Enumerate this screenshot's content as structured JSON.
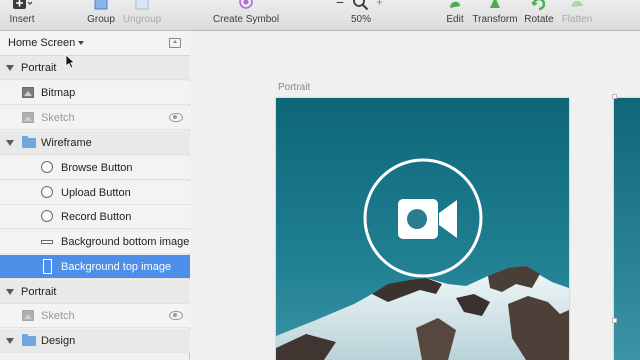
{
  "toolbar": {
    "insert": "Insert",
    "group": "Group",
    "ungroup": "Ungroup",
    "create_symbol": "Create Symbol",
    "zoom_minus": "−",
    "zoom_plus": "+",
    "zoom": "50%",
    "edit": "Edit",
    "transform": "Transform",
    "rotate": "Rotate",
    "flatten": "Flatten"
  },
  "sidebar": {
    "page_name": "Home Screen",
    "layers": [
      {
        "label": "Portrait",
        "type": "artboard"
      },
      {
        "label": "Bitmap",
        "type": "bitmap"
      },
      {
        "label": "Sketch",
        "type": "bitmap-hidden"
      },
      {
        "label": "Wireframe",
        "type": "folder"
      },
      {
        "label": "Browse Button",
        "type": "oval"
      },
      {
        "label": "Upload Button",
        "type": "oval"
      },
      {
        "label": "Record Button",
        "type": "oval"
      },
      {
        "label": "Background bottom image",
        "type": "line"
      },
      {
        "label": "Background top image",
        "type": "rect",
        "selected": true
      },
      {
        "label": "Portrait",
        "type": "artboard"
      },
      {
        "label": "Sketch",
        "type": "bitmap-hidden"
      },
      {
        "label": "Design",
        "type": "folder"
      }
    ]
  },
  "canvas": {
    "artboard_label": "Portrait",
    "icon": "video-camera-icon"
  },
  "colors": {
    "selection": "#4d8ee8",
    "toolbar_green": "#47b04b",
    "symbol_purple": "#b36ad6",
    "folder_blue": "#6fa8dc",
    "sky": "#1e7f91"
  }
}
